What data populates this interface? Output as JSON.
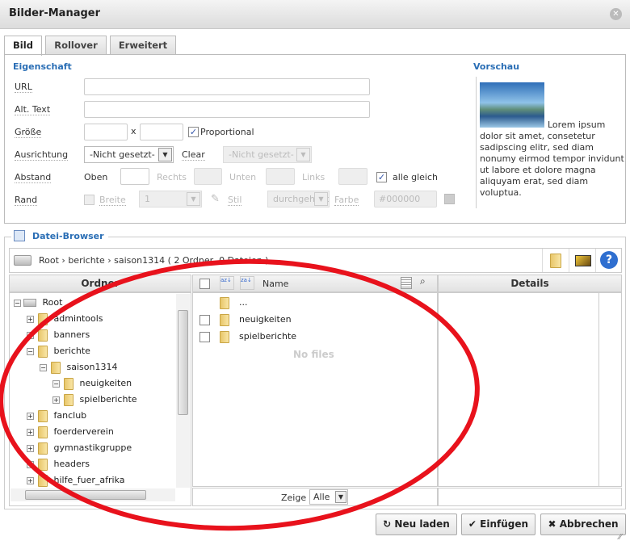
{
  "window": {
    "title": "Bilder-Manager"
  },
  "tabs": [
    {
      "label": "Bild"
    },
    {
      "label": "Rollover"
    },
    {
      "label": "Erweitert"
    }
  ],
  "properties": {
    "section": "Eigenschaft",
    "url_label": "URL",
    "alt_label": "Alt. Text",
    "size_label": "Größe",
    "size_x": "x",
    "proportional_label": "Proportional",
    "proportional_checked": true,
    "align_label": "Ausrichtung",
    "align_value": "-Nicht gesetzt-",
    "clear_label": "Clear",
    "clear_value": "-Nicht gesetzt-",
    "spacing_label": "Abstand",
    "top_label": "Oben",
    "right_label": "Rechts",
    "bottom_label": "Unten",
    "left_label": "Links",
    "all_equal_label": "alle gleich",
    "all_equal_checked": true,
    "border_label": "Rand",
    "width_label": "Breite",
    "width_value": "1",
    "style_label": "Stil",
    "style_value": "durchgehend",
    "color_label": "Farbe",
    "color_value": "#000000"
  },
  "preview": {
    "section": "Vorschau",
    "text": "Lorem ipsum dolor sit amet, consetetur sadipscing elitr, sed diam nonumy eirmod tempor invidunt ut labore et dolore magna aliquyam erat, sed diam voluptua."
  },
  "browser": {
    "section": "Datei-Browser",
    "breadcrumb": "Root › berichte › saison1314",
    "summary": "( 2 Ordner, 0 Dateien )",
    "folders_header": "Ordner",
    "name_header": "Name",
    "details_header": "Details",
    "tree": [
      {
        "label": "Root",
        "level": 0,
        "toggle": "−"
      },
      {
        "label": "admintools",
        "level": 1,
        "toggle": "+"
      },
      {
        "label": "banners",
        "level": 1,
        "toggle": "+"
      },
      {
        "label": "berichte",
        "level": 1,
        "toggle": "−"
      },
      {
        "label": "saison1314",
        "level": 2,
        "toggle": "−"
      },
      {
        "label": "neuigkeiten",
        "level": 3,
        "toggle": "−"
      },
      {
        "label": "spielberichte",
        "level": 3,
        "toggle": "+"
      },
      {
        "label": "fanclub",
        "level": 1,
        "toggle": "+"
      },
      {
        "label": "foerderverein",
        "level": 1,
        "toggle": "+"
      },
      {
        "label": "gymnastikgruppe",
        "level": 1,
        "toggle": "+"
      },
      {
        "label": "headers",
        "level": 1,
        "toggle": "+"
      },
      {
        "label": "hilfe_fuer_afrika",
        "level": 1,
        "toggle": "+"
      }
    ],
    "files": [
      {
        "label": "..."
      },
      {
        "label": "neuigkeiten"
      },
      {
        "label": "spielberichte"
      }
    ],
    "empty_text": "No files",
    "show_label": "Zeige",
    "show_value": "Alle"
  },
  "buttons": {
    "reload": "Neu laden",
    "insert": "Einfügen",
    "cancel": "Abbrechen"
  },
  "colors": {
    "accent": "#2a6eb5",
    "annotation": "#e8121c"
  }
}
